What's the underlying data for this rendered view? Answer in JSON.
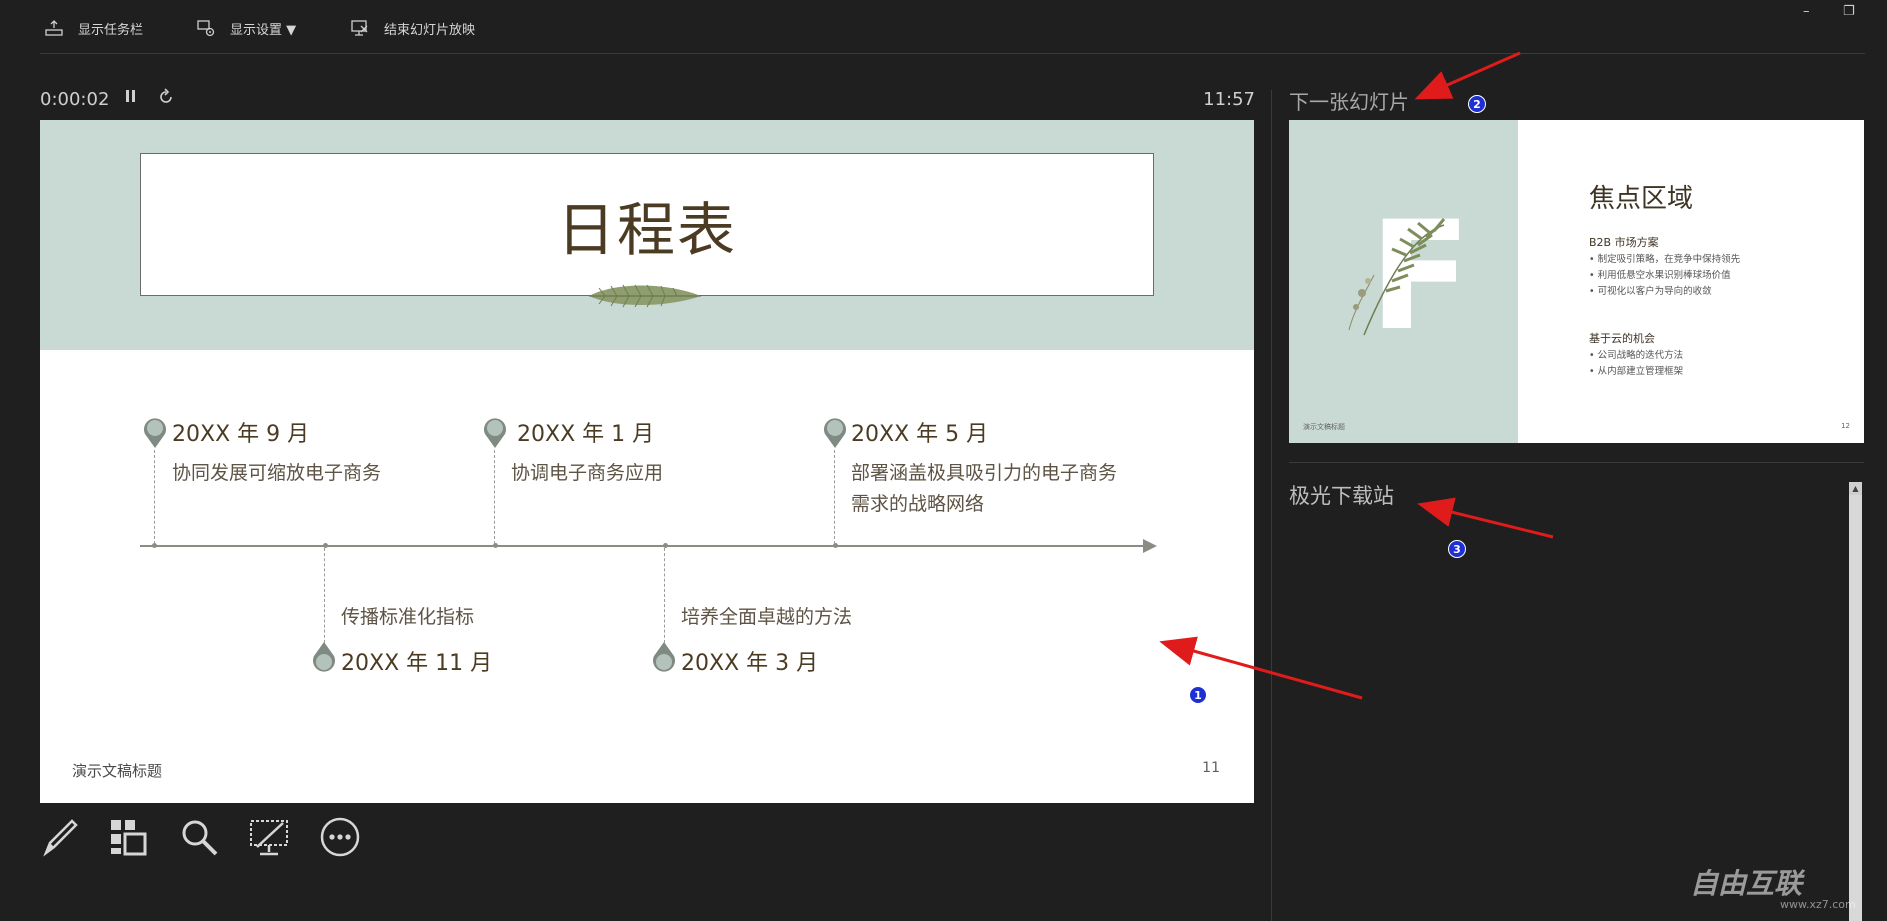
{
  "toolbar": {
    "taskbar_label": "显示任务栏",
    "display_settings_label": "显示设置 ▼",
    "end_show_label": "结束幻灯片放映"
  },
  "window": {
    "minimize": "–",
    "restore": "❐"
  },
  "presenter": {
    "elapsed": "0:00:02",
    "clock": "11:57"
  },
  "slide": {
    "title": "日程表",
    "events": [
      {
        "date": "20XX 年 9 月",
        "desc": "协同发展可缩放电子商务"
      },
      {
        "date": "20XX 年 11 月",
        "desc": "传播标准化指标"
      },
      {
        "date": "20XX 年 1 月",
        "desc": "协调电子商务应用"
      },
      {
        "date": "20XX 年 3 月",
        "desc": "培养全面卓越的方法"
      },
      {
        "date": "20XX 年 5 月",
        "desc": "部署涵盖极具吸引力的电子商务需求的战略网络"
      }
    ],
    "footer": "演示文稿标题",
    "number": "11"
  },
  "next_slide": {
    "label": "下一张幻灯片",
    "big_letter": "F",
    "title": "焦点区域",
    "section1": "B2B 市场方案",
    "bullets1": [
      "制定吸引策略，在竞争中保持领先",
      "利用低悬空水果识别棒球场价值",
      "可视化以客户为导向的收敛"
    ],
    "section2": "基于云的机会",
    "bullets2": [
      "公司战略的迭代方法",
      "从内部建立管理框架"
    ],
    "footer": "演示文稿标题",
    "number": "12"
  },
  "notes": {
    "text": "极光下载站"
  },
  "annotations": [
    "1",
    "2",
    "3"
  ],
  "accent_colors": {
    "slide_header": "#c9d9d3",
    "arrow": "#e01b1b",
    "badge": "#1f2fd6"
  },
  "watermark": {
    "brand": "自由互联",
    "url": "www.xz7.com"
  }
}
